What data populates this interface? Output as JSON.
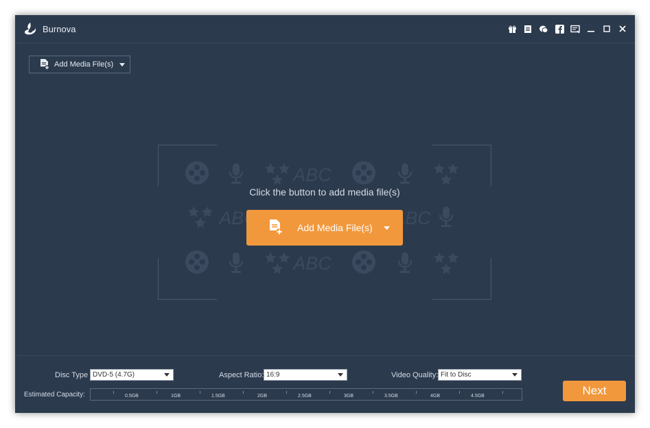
{
  "app": {
    "title": "Burnova"
  },
  "toolbar": {
    "add_media_label": "Add Media File(s)"
  },
  "dropzone": {
    "hint": "Click the button to add media file(s)",
    "add_media_label": "Add Media File(s)",
    "watermark_text": "ABC"
  },
  "settings": {
    "disc_type_label": "Disc Type",
    "disc_type_value": "DVD-5 (4.7G)",
    "aspect_ratio_label": "Aspect Ratio:",
    "aspect_ratio_value": "16:9",
    "video_quality_label": "Video Quality:",
    "video_quality_value": "Fit to Disc",
    "capacity_label": "Estimated Capacity:",
    "capacity_ticks": [
      "0.5GB",
      "1GB",
      "1.5GB",
      "2GB",
      "2.5GB",
      "3GB",
      "3.5GB",
      "4GB",
      "4.5GB"
    ]
  },
  "next_label": "Next",
  "colors": {
    "background": "#2c3a4d",
    "accent": "#f2983c",
    "text": "#d5dde7"
  },
  "icons": [
    "logo-icon",
    "gift-icon",
    "register-icon",
    "chat-icon",
    "facebook-icon",
    "feedback-icon",
    "minimize-icon",
    "maximize-icon",
    "close-icon",
    "add-file-icon",
    "dropdown-caret-icon"
  ]
}
